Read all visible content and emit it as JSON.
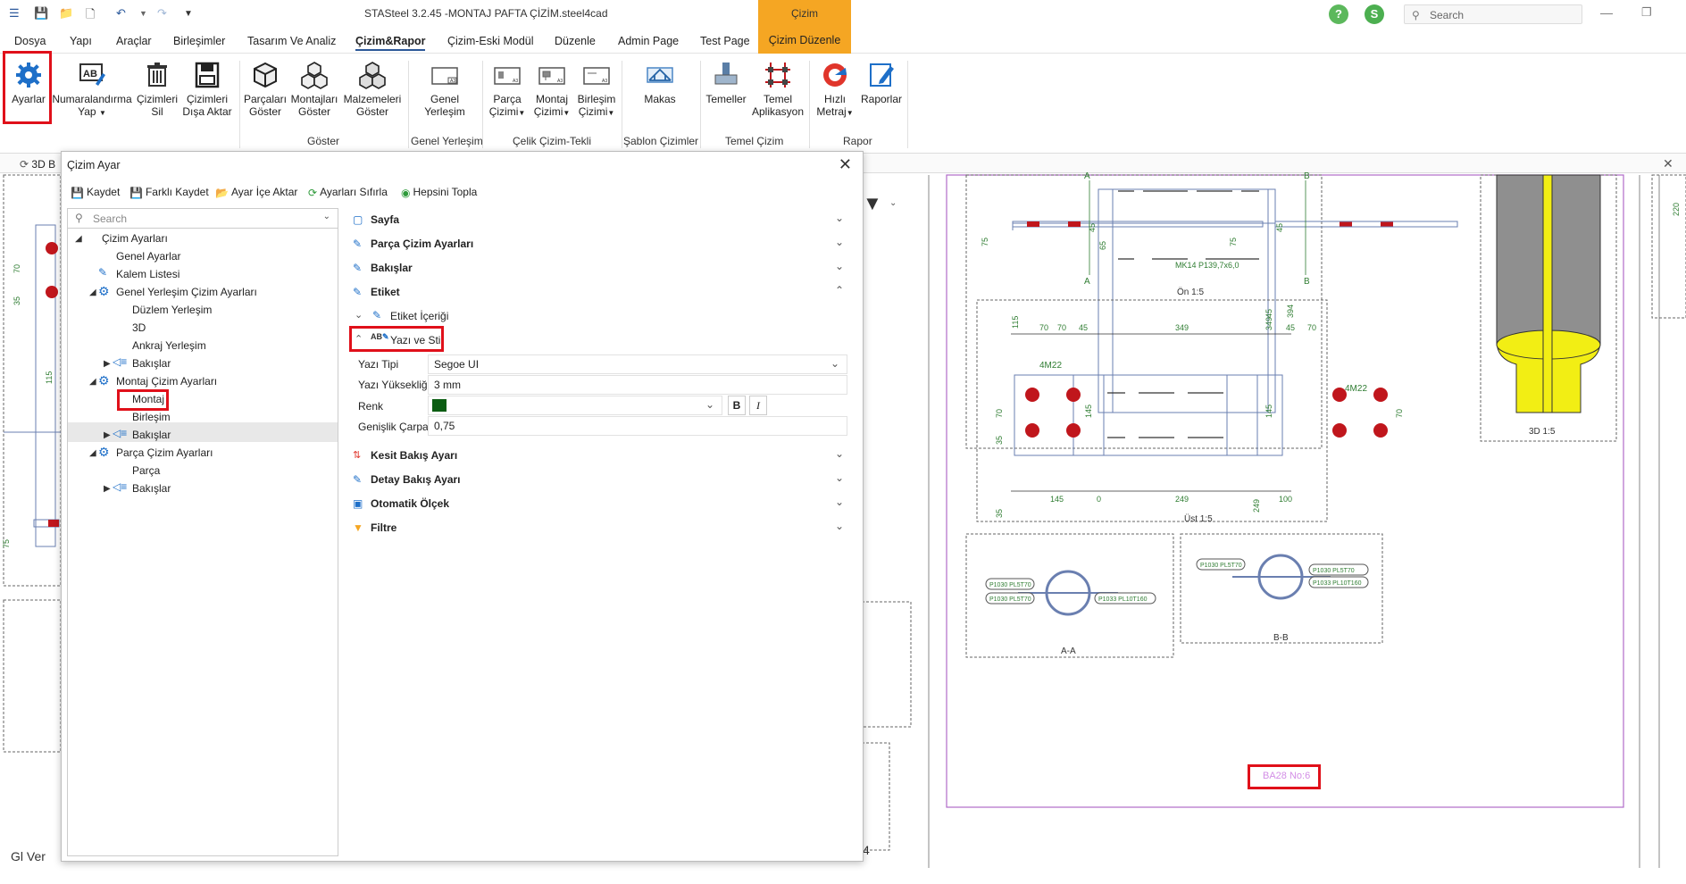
{
  "window": {
    "title": "STASteel 3.2.45 -MONTAJ PAFTA ÇİZİM.steel4cad",
    "context_tab_header": "Çizim",
    "avatar_letter": "S",
    "help_letter": "?",
    "search_placeholder": "Search"
  },
  "menu": {
    "tabs": [
      "Dosya",
      "Yapı",
      "Araçlar",
      "Birleşimler",
      "Tasarım Ve Analiz",
      "Çizim&Rapor",
      "Çizim-Eski Modül",
      "Düzenle",
      "Admin Page",
      "Test Page"
    ],
    "active": "Çizim&Rapor",
    "context_tab": "Çizim Düzenle"
  },
  "ribbon": {
    "buttons": {
      "ayarlar": "Ayarlar",
      "numaralandirma_1": "Numaralandırma",
      "numaralandirma_2": "Yap",
      "cizimleri_sil_1": "Çizimleri",
      "cizimleri_sil_2": "Sil",
      "cizimleri_disa_1": "Çizimleri",
      "cizimleri_disa_2": "Dışa Aktar",
      "parcalari_1": "Parçaları",
      "parcalari_2": "Göster",
      "montajlari_1": "Montajları",
      "montajlari_2": "Göster",
      "malzemeleri_1": "Malzemeleri",
      "malzemeleri_2": "Göster",
      "genel_yerlesim_1": "Genel",
      "genel_yerlesim_2": "Yerleşim",
      "parca_cizimi_1": "Parça",
      "parca_cizimi_2": "Çizimi",
      "montaj_cizimi_1": "Montaj",
      "montaj_cizimi_2": "Çizimi",
      "birlesim_cizimi_1": "Birleşim",
      "birlesim_cizimi_2": "Çizimi",
      "makas": "Makas",
      "temeller": "Temeller",
      "temel_aplikasyon_1": "Temel",
      "temel_aplikasyon_2": "Aplikasyon",
      "hizli_metraj_1": "Hızlı",
      "hizli_metraj_2": "Metraj",
      "raporlar": "Raporlar"
    },
    "groups": {
      "goster": "Göster",
      "genel_yerlesim": "Genel Yerleşim",
      "celik_cizim": "Çelik Çizim-Tekli",
      "sablon": "Şablon Çizimler",
      "temel": "Temel Çizim",
      "rapor": "Rapor"
    }
  },
  "dialog": {
    "title": "Çizim Ayar",
    "toolbar": {
      "kaydet": "Kaydet",
      "farkli_kaydet": "Farklı Kaydet",
      "ayar_ice_aktar": "Ayar İçe Aktar",
      "ayarlari_sifirla": "Ayarları Sıfırla",
      "hepsini_topla": "Hepsini Topla"
    },
    "tree_search_placeholder": "Search",
    "tree": {
      "cizim_ayarlari": "Çizim Ayarları",
      "genel_ayarlar": "Genel Ayarlar",
      "kalem_listesi": "Kalem Listesi",
      "genel_yerlesim_cizim": "Genel Yerleşim Çizim Ayarları",
      "duzlem_yerlesim": "Düzlem Yerleşim",
      "uc_d": "3D",
      "ankraj_yerlesim": "Ankraj Yerleşim",
      "bakislar_1": "Bakışlar",
      "montaj_cizim": "Montaj Çizim Ayarları",
      "montaj": "Montaj",
      "birlesim": "Birleşim",
      "bakislar_2": "Bakışlar",
      "parca_cizim": "Parça Çizim Ayarları",
      "parca": "Parça",
      "bakislar_3": "Bakışlar"
    },
    "sections": {
      "sayfa": "Sayfa",
      "parca_cizim_ayarlari": "Parça Çizim Ayarları",
      "bakislar": "Bakışlar",
      "etiket": "Etiket",
      "etiket_icerigi": "Etiket İçeriği",
      "yazi_ve_stil": "Yazı ve Stil",
      "kesit_bakis": "Kesit Bakış Ayarı",
      "detay_bakis": "Detay Bakış Ayarı",
      "otomatik_olcek": "Otomatik Ölçek",
      "filtre": "Filtre"
    },
    "props": {
      "yazi_tipi_label": "Yazı Tipi",
      "yazi_tipi_value": "Segoe UI",
      "yazi_yuksekligi_label": "Yazı Yüksekliği",
      "yazi_yuksekligi_value": "3 mm",
      "renk_label": "Renk",
      "renk_value": "#0b5d12",
      "genislik_label": "Genişlik Çarpanı",
      "genislik_value": "0,75",
      "bold": "B",
      "italic": "I"
    }
  },
  "drawing": {
    "tab_label": "3D B",
    "bottom_left": "Gl Ver",
    "profile_label": "MK14 P139,7x6,0",
    "view_on": "Ön 1:5",
    "view_ust": "Üst 1:5",
    "view_3d": "3D 1:5",
    "view_aa": "A-A",
    "view_bb": "B-B",
    "assembly_label": "BA28 No:6",
    "bolt_label_1": "4M22",
    "bolt_label_2": "4M22",
    "part_tags": [
      "P1030 PL5T70",
      "P1030 PL5T70",
      "P1033 PL10T160",
      "P1030 PL5T70",
      "P1030 PL5T70",
      "P1033 PL10T160"
    ],
    "section_letters": [
      "A",
      "B",
      "A",
      "B"
    ],
    "dims_top": [
      "115",
      "70",
      "70",
      "45",
      "349",
      "349",
      "45",
      "70",
      "45",
      "394"
    ],
    "dims_bottom": [
      "145",
      "0",
      "249",
      "249",
      "100"
    ],
    "dims_left_top": [
      "45",
      "65",
      "75",
      "75",
      "45"
    ],
    "dims_left_ust": [
      "70",
      "35",
      "145",
      "145",
      "70",
      "35"
    ],
    "dims_leftview": [
      "70",
      "35",
      "115"
    ],
    "dim_right": "220",
    "bottom_right_digit": "4",
    "left_dim": "75"
  },
  "colors": {
    "accent": "#2b5797",
    "context_tab": "#f5a623",
    "highlight_box": "#e0101a",
    "drawing_green": "#2f7d32",
    "bolt_red": "#c0161c",
    "column_yellow": "#f2ee14"
  }
}
